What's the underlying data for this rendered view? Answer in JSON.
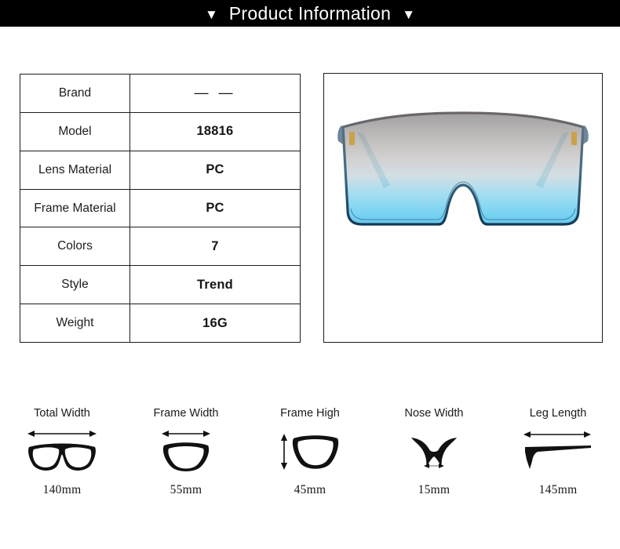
{
  "header": {
    "left_arrow_icon": "triangle-down-icon",
    "title": "Product Information",
    "right_arrow_icon": "triangle-down-icon",
    "background_color": "#000000",
    "text_color": "#ffffff"
  },
  "spec_table": {
    "rows": [
      {
        "key": "Brand",
        "value": "— —"
      },
      {
        "key": "Model",
        "value": "18816"
      },
      {
        "key": "Lens Material",
        "value": "PC"
      },
      {
        "key": "Frame Material",
        "value": "PC"
      },
      {
        "key": "Colors",
        "value": "7"
      },
      {
        "key": "Style",
        "value": "Trend"
      },
      {
        "key": "Weight",
        "value": "16G"
      }
    ]
  },
  "product_image": {
    "name": "sunglasses-product-photo",
    "description": "Square shield sunglasses, front view",
    "lens_gradient_top": "#8e8a8c",
    "lens_gradient_mid": "#c9c7c6",
    "lens_gradient_bottom": "#55c8ef",
    "frame_color": "#1d3a52",
    "temple_color": "#62bcd8",
    "hinge_color": "#c9a24a",
    "background": "#ffffff"
  },
  "measurements": [
    {
      "label": "Total Width",
      "value": "140mm",
      "icon": "glasses-full-frame-icon",
      "arrow": "horizontal-double-arrow-icon"
    },
    {
      "label": "Frame Width",
      "value": "55mm",
      "icon": "single-lens-icon",
      "arrow": "horizontal-double-arrow-icon"
    },
    {
      "label": "Frame High",
      "value": "45mm",
      "icon": "single-lens-icon",
      "arrow": "vertical-double-arrow-icon"
    },
    {
      "label": "Nose Width",
      "value": "15mm",
      "icon": "nose-bridge-icon",
      "arrow": "horizontal-double-arrow-icon"
    },
    {
      "label": "Leg Length",
      "value": "145mm",
      "icon": "temple-arm-icon",
      "arrow": "horizontal-double-arrow-icon"
    }
  ]
}
